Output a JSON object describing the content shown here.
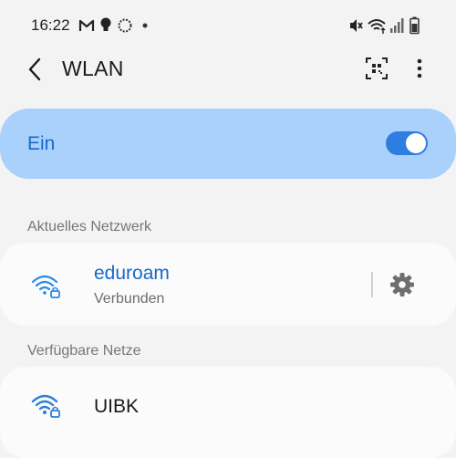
{
  "status_bar": {
    "time": "16:22",
    "left_icons": [
      "gmail-icon",
      "lightbulb-icon",
      "sync-icon",
      "notification-dot-icon"
    ],
    "right_icons": [
      "mute-icon",
      "wifi-status-icon",
      "signal-icon",
      "battery-icon"
    ]
  },
  "app_bar": {
    "title": "WLAN",
    "icons": [
      "back-arrow-icon",
      "qr-code-icon",
      "more-options-icon"
    ]
  },
  "master_toggle": {
    "label": "Ein",
    "state": "on"
  },
  "current_network": {
    "section_title": "Aktuelles Netzwerk",
    "name": "eduroam",
    "status": "Verbunden",
    "icon": "wifi-lock-icon",
    "action_icon": "gear-icon"
  },
  "available_networks": {
    "section_title": "Verfügbare Netze",
    "items": [
      {
        "name": "UIBK",
        "icon": "wifi-lock-icon"
      }
    ]
  },
  "colors": {
    "accent": "#1769c9",
    "toggle_card_bg": "#aad1fb",
    "switch_on": "#2d7ee0",
    "wifi_connected": "#2a8ae8",
    "wifi_available": "#2f7fda",
    "background": "#f3f3f3",
    "card": "#fbfbfb"
  }
}
